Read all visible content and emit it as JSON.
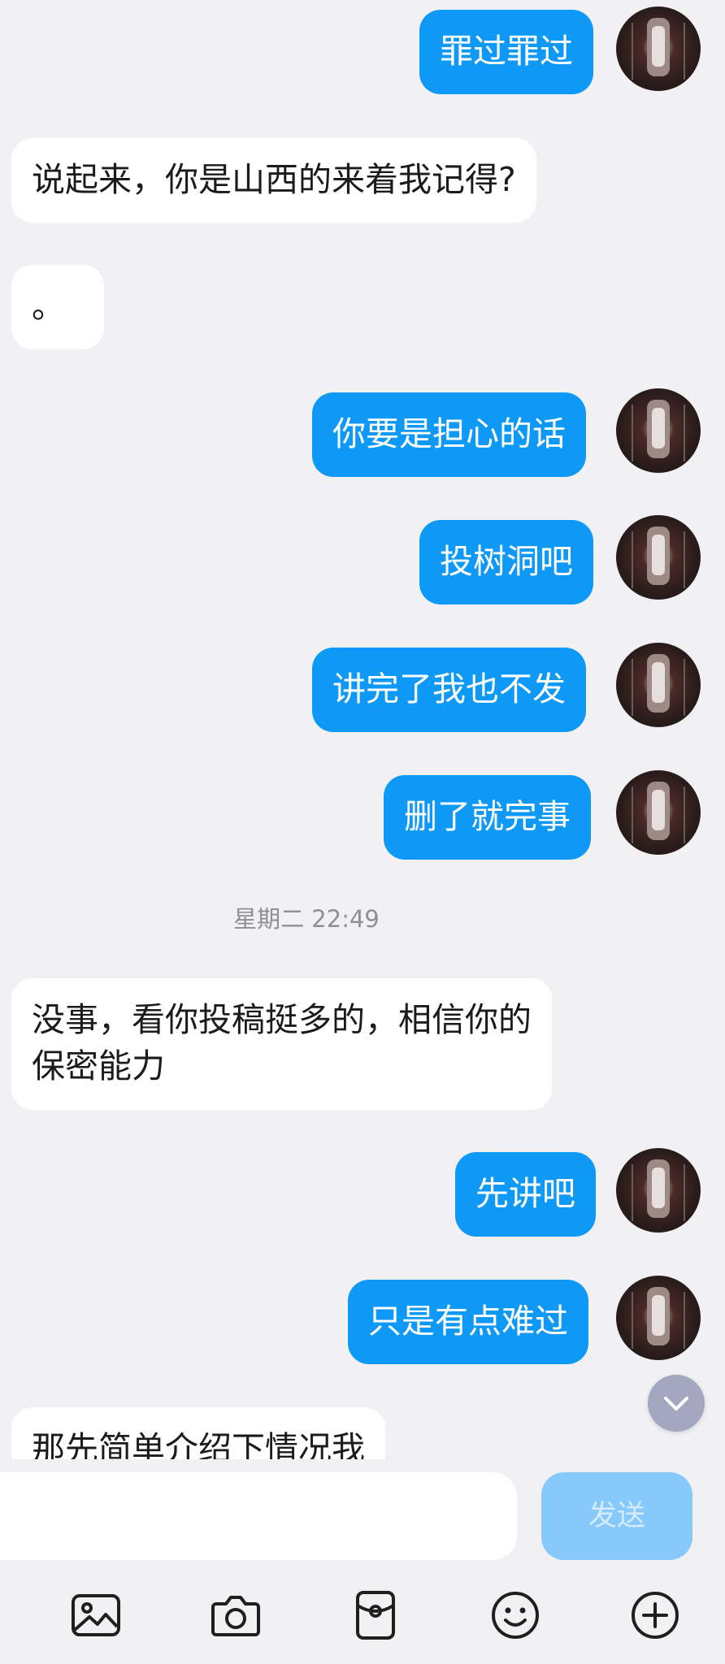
{
  "messages": [
    {
      "direction": "out",
      "text": "罪过罪过"
    },
    {
      "direction": "in",
      "text": "说起来，你是山西的来着我记得?"
    },
    {
      "direction": "in",
      "text": "。"
    },
    {
      "direction": "out",
      "text": "你要是担心的话"
    },
    {
      "direction": "out",
      "text": "投树洞吧"
    },
    {
      "direction": "out",
      "text": "讲完了我也不发"
    },
    {
      "direction": "out",
      "text": "删了就完事"
    },
    {
      "direction": "in",
      "text_line1": "没事，看你投稿挺多的，相信你的",
      "text_line2": "保密能力"
    },
    {
      "direction": "out",
      "text": "先讲吧"
    },
    {
      "direction": "out",
      "text": "只是有点难过"
    },
    {
      "direction": "in",
      "text": "那先简单介绍下情况我"
    }
  ],
  "timestamp": "星期二 22:49",
  "input": {
    "value": "",
    "placeholder": ""
  },
  "send_label": "发送",
  "toolbar": {
    "icons": [
      "image-icon",
      "camera-icon",
      "red-packet-icon",
      "emoji-icon",
      "add-icon"
    ]
  },
  "colors": {
    "outgoing_bubble": "#0f99f6",
    "incoming_bubble": "#ffffff",
    "send_button_disabled": "#86c9fa",
    "background": "#f1f1f3"
  }
}
